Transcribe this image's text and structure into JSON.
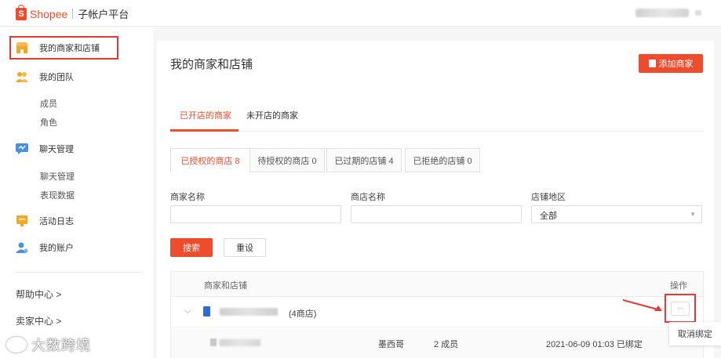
{
  "header": {
    "brand": "Shopee",
    "logo_letter": "S",
    "subtitle": "子帐户平台"
  },
  "sidebar": {
    "items": [
      {
        "label": "我的商家和店铺",
        "icon": "store-icon",
        "color": "#f5a623"
      },
      {
        "label": "我的团队",
        "icon": "team-icon",
        "color": "#f5a623"
      },
      {
        "label": "成员"
      },
      {
        "label": "角色"
      },
      {
        "label": "聊天管理",
        "icon": "chat-icon",
        "color": "#4a90e2"
      },
      {
        "label": "聊天管理"
      },
      {
        "label": "表现数据"
      },
      {
        "label": "活动日志",
        "icon": "log-icon",
        "color": "#f5a623"
      },
      {
        "label": "我的账户",
        "icon": "account-icon",
        "color": "#4a90e2"
      }
    ],
    "links": [
      "帮助中心 >",
      "卖家中心 >"
    ]
  },
  "main": {
    "title": "我的商家和店铺",
    "add_button": "添加商家",
    "tabs": [
      "已开店的商家",
      "未开店的商家"
    ],
    "subtabs": [
      "已授权的商店 8",
      "待授权的商店 0",
      "已过期的店铺 4",
      "已拒绝的店铺 0"
    ],
    "filters": {
      "merchant_label": "商家名称",
      "shop_label": "商店名称",
      "region_label": "店铺地区",
      "region_value": "全部"
    },
    "search_button": "搜索",
    "reset_button": "重设",
    "table": {
      "col_merchant": "商家和店铺",
      "col_action": "操作",
      "row_count": "(4商店)",
      "sub_region": "墨西哥",
      "sub_members": "2 成员",
      "sub_bound": "2021-06-09 01:03 已绑定"
    },
    "more_button": "...",
    "dropdown_item": "取消绑定"
  },
  "watermark": "大数跨境",
  "accent_color": "#ee4d2d"
}
